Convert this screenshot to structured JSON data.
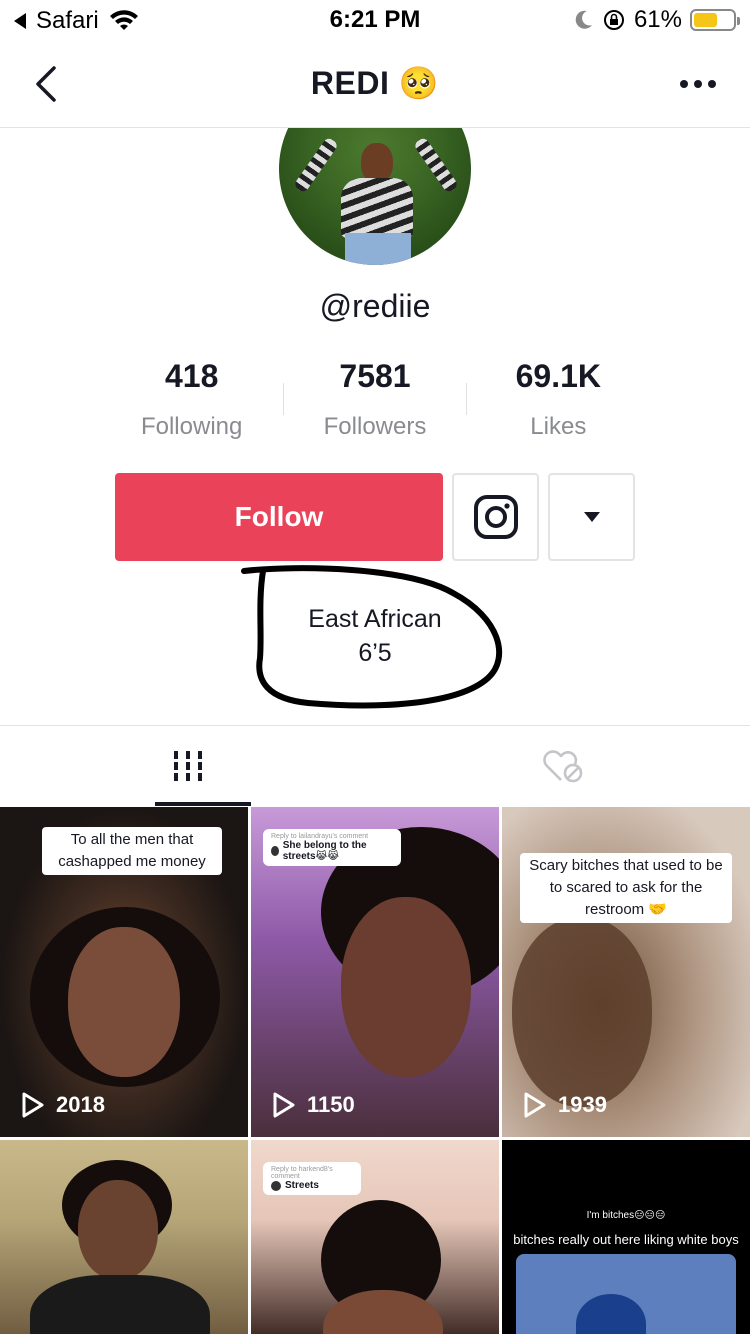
{
  "status": {
    "carrier": "Safari",
    "time": "6:21 PM",
    "battery": "61%",
    "battery_level": 0.61
  },
  "nav": {
    "title": "REDI 🥺"
  },
  "profile": {
    "username": "@rediie",
    "stats": [
      {
        "value": "418",
        "label": "Following"
      },
      {
        "value": "7581",
        "label": "Followers"
      },
      {
        "value": "69.1K",
        "label": "Likes"
      }
    ],
    "follow_label": "Follow",
    "bio_line1": "East African",
    "bio_line2": "6’5"
  },
  "videos": [
    {
      "caption": "To all the men that cashapped me money",
      "views": "2018"
    },
    {
      "reply_head": "Reply to lailandrayu's comment",
      "reply_text": "She belong to the streets😹😹",
      "views": "1150"
    },
    {
      "caption": "Scary bitches that used to be to scared to ask for the restroom 🤝",
      "views": "1939"
    },
    {},
    {
      "reply_head": "Reply to harkend8's comment",
      "reply_text": "Streets"
    },
    {
      "meme_sub": "I'm bitches😑😑😑",
      "meme_main": "bitches really out here liking white boys"
    }
  ],
  "colors": {
    "follow": "#ea4359",
    "text": "#161823",
    "muted": "#8a8b91"
  }
}
